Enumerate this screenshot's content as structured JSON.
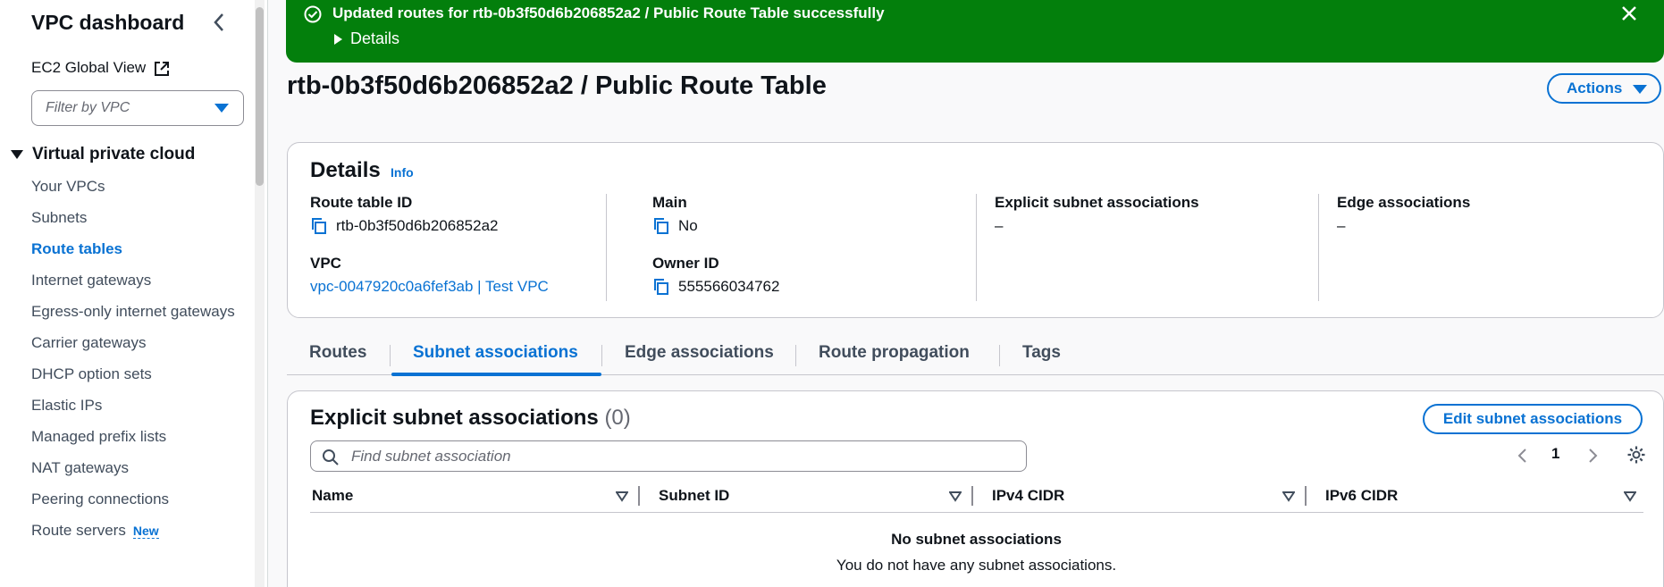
{
  "sidebar": {
    "title": "VPC dashboard",
    "ec2_global_view": "EC2 Global View",
    "filter_placeholder": "Filter by VPC",
    "section": "Virtual private cloud",
    "items": [
      {
        "label": "Your VPCs"
      },
      {
        "label": "Subnets"
      },
      {
        "label": "Route tables",
        "active": true
      },
      {
        "label": "Internet gateways"
      },
      {
        "label": "Egress-only internet gateways"
      },
      {
        "label": "Carrier gateways"
      },
      {
        "label": "DHCP option sets"
      },
      {
        "label": "Elastic IPs"
      },
      {
        "label": "Managed prefix lists"
      },
      {
        "label": "NAT gateways"
      },
      {
        "label": "Peering connections"
      },
      {
        "label": "Route servers",
        "badge": "New"
      }
    ]
  },
  "flash": {
    "message": "Updated routes for rtb-0b3f50d6b206852a2 / Public Route Table successfully",
    "details": "Details",
    "color": "#037f0c"
  },
  "page": {
    "title": "rtb-0b3f50d6b206852a2 / Public Route Table",
    "actions": "Actions"
  },
  "details": {
    "heading": "Details",
    "info": "Info",
    "route_table_id_label": "Route table ID",
    "route_table_id": "rtb-0b3f50d6b206852a2",
    "vpc_label": "VPC",
    "vpc": "vpc-0047920c0a6fef3ab | Test VPC",
    "main_label": "Main",
    "main": "No",
    "owner_label": "Owner ID",
    "owner": "555566034762",
    "explicit_label": "Explicit subnet associations",
    "explicit": "–",
    "edge_label": "Edge associations",
    "edge": "–"
  },
  "tabs": [
    {
      "label": "Routes"
    },
    {
      "label": "Subnet associations",
      "active": true
    },
    {
      "label": "Edge associations"
    },
    {
      "label": "Route propagation"
    },
    {
      "label": "Tags"
    }
  ],
  "subnets": {
    "heading": "Explicit subnet associations",
    "count": "(0)",
    "edit_button": "Edit subnet associations",
    "search_placeholder": "Find subnet association",
    "page": "1",
    "columns": [
      "Name",
      "Subnet ID",
      "IPv4 CIDR",
      "IPv6 CIDR"
    ],
    "empty_title": "No subnet associations",
    "empty_text": "You do not have any subnet associations."
  },
  "colors": {
    "accent": "#0972d3",
    "success": "#037f0c"
  }
}
